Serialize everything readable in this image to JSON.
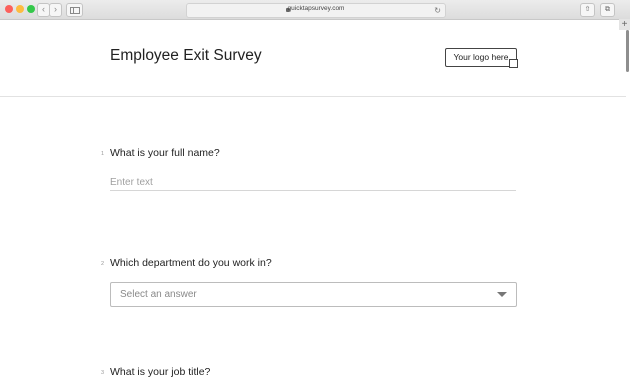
{
  "browser": {
    "url": "quicktapsurvey.com",
    "back_icon": "‹",
    "forward_icon": "›",
    "reload_icon": "↻",
    "share_icon": "⇧",
    "tabs_icon": "⧉",
    "newtab_icon": "+"
  },
  "survey": {
    "title": "Employee Exit Survey",
    "logo_label": "Your logo here"
  },
  "questions": [
    {
      "number": "1",
      "text": "What is your full name?",
      "placeholder": "Enter text"
    },
    {
      "number": "2",
      "text": "Which department do you work in?",
      "placeholder": "Select an answer"
    },
    {
      "number": "3",
      "text": "What is your job title?"
    }
  ]
}
